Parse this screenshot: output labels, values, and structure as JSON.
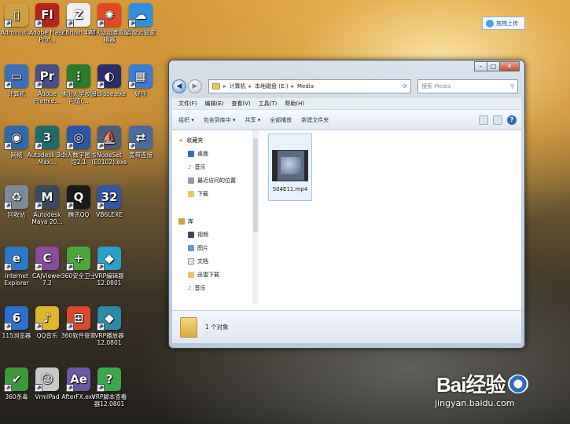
{
  "desktop_icons": [
    {
      "label": "Administ...",
      "color": "#c9a246",
      "glyph": "▯"
    },
    {
      "label": "Adobe Flash Prof...",
      "color": "#b5231b",
      "glyph": "Fl"
    },
    {
      "label": "ZBrush 4R6",
      "color": "#f0f0f0",
      "glyph": "Z"
    },
    {
      "label": "ATX动动通道编辑器",
      "color": "#e24a24",
      "glyph": "✺"
    },
    {
      "label": "百度云管家",
      "color": "#2f8fde",
      "glyph": "☁"
    },
    {
      "label": "计算机",
      "color": "#3b6fb8",
      "glyph": "▭"
    },
    {
      "label": "Adobe Premie...",
      "color": "#4b4e87",
      "glyph": "Pr"
    },
    {
      "label": "佛山大学校园闪值(...",
      "color": "#2c7a2c",
      "glyph": "⋮"
    },
    {
      "label": "eclipse.exe",
      "color": "#2a2f6a",
      "glyph": "◐"
    },
    {
      "label": "好压",
      "color": "#3b7bd0",
      "glyph": "▦"
    },
    {
      "label": "网络",
      "color": "#2c6aa8",
      "glyph": "◉"
    },
    {
      "label": "Autodesk 3ds Max...",
      "color": "#1f6b6b",
      "glyph": "3"
    },
    {
      "label": "个人数字图书馆2.1",
      "color": "#2a55a8",
      "glyph": "◎"
    },
    {
      "label": "NodeSet (E0102).exe",
      "color": "#4d5d7a",
      "glyph": "⛵"
    },
    {
      "label": "宽带连接",
      "color": "#4a6aa0",
      "glyph": "⇄"
    },
    {
      "label": "回收站",
      "color": "#7c8a99",
      "glyph": "♻"
    },
    {
      "label": "Autodesk Maya 20...",
      "color": "#3a4a5c",
      "glyph": "M"
    },
    {
      "label": "腾讯QQ",
      "color": "#1a1a1a",
      "glyph": "Q"
    },
    {
      "label": "VB6LEXE",
      "color": "#3357a8",
      "glyph": "32"
    },
    {
      "label": "Internet Explorer",
      "color": "#2a79c9",
      "glyph": "e"
    },
    {
      "label": "CAJViewer 7.2",
      "color": "#8a4aa0",
      "glyph": "C"
    },
    {
      "label": "360安全卫士",
      "color": "#4aa83a",
      "glyph": "+"
    },
    {
      "label": "VRP编辑器12.0801",
      "color": "#2aa0c9",
      "glyph": "◆"
    },
    {
      "label": "115浏览器",
      "color": "#2b6fd0",
      "glyph": "6"
    },
    {
      "label": "QQ音乐",
      "color": "#e0b62a",
      "glyph": "♪"
    },
    {
      "label": "360软件管家",
      "color": "#d84a2a",
      "glyph": "⊞"
    },
    {
      "label": "VRP播放器12.0801",
      "color": "#2a8aa8",
      "glyph": "◆"
    },
    {
      "label": "360杀毒",
      "color": "#3a9a3a",
      "glyph": "✔"
    },
    {
      "label": "VrmlPad",
      "color": "#c9c9c9",
      "glyph": "☺"
    },
    {
      "label": "AfterFX.exe",
      "color": "#6a5aa8",
      "glyph": "Ae"
    },
    {
      "label": "VRP脚本查看器12.0801",
      "color": "#3aa84a",
      "glyph": "?"
    }
  ],
  "upload_button": {
    "label": "拖拽上传"
  },
  "window": {
    "address": {
      "crumbs": [
        "计算机",
        "本地磁盘 (E:)",
        "Media"
      ]
    },
    "search_placeholder": "搜索 Media",
    "menu": [
      "文件(F)",
      "编辑(E)",
      "查看(V)",
      "工具(T)",
      "帮助(H)"
    ],
    "toolbar": [
      "组织 ▾",
      "包含到库中 ▾",
      "共享 ▾",
      "全部播放",
      "新建文件夹"
    ],
    "nav": {
      "favorites_label": "收藏夹",
      "favorites": [
        "桌面",
        "音乐",
        "最近访问的位置",
        "下载"
      ],
      "library_label": "库",
      "libraries": [
        "视频",
        "图片",
        "文档",
        "迅雷下载",
        "音乐"
      ]
    },
    "file": {
      "name": "S04E11.mp4"
    },
    "status": {
      "count": "1 个对象"
    }
  },
  "watermark": {
    "brand": "Bai经验",
    "url": "jingyan.baidu.com"
  }
}
